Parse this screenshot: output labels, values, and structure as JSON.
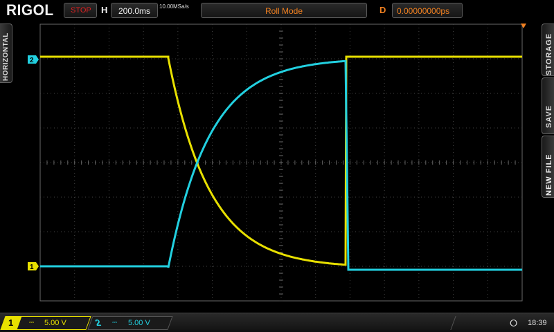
{
  "header": {
    "brand": "RIGOL",
    "run_status": "STOP",
    "horizontal_label": "H",
    "timebase": "200.0ms",
    "sample_rate": "10.00MSa/s",
    "mode": "Roll Mode",
    "delay_label": "D",
    "delay": "0.00000000ps"
  },
  "side_tabs": {
    "left": "HORIZONTAL",
    "right": [
      "STORAGE",
      "SAVE",
      "NEW FILE"
    ]
  },
  "channels": [
    {
      "num": "1",
      "coupling": "⎓",
      "scale": "5.00 V",
      "color": "#e8e000",
      "marker": "1"
    },
    {
      "num": "2",
      "coupling": "⎓",
      "scale": "5.00 V",
      "color": "#22d0e0",
      "marker": "2"
    }
  ],
  "status": {
    "usb_icon": "usb-icon",
    "time": "18:39"
  }
}
